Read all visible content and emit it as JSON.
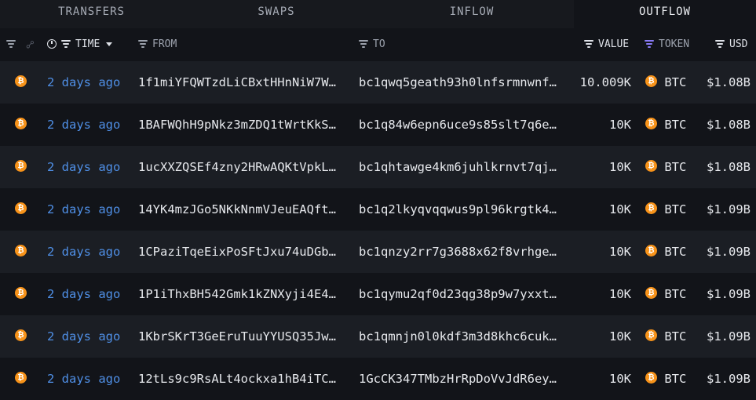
{
  "tabs": [
    {
      "label": "TRANSFERS",
      "active": false
    },
    {
      "label": "SWAPS",
      "active": false
    },
    {
      "label": "INFLOW",
      "active": false
    },
    {
      "label": "OUTFLOW",
      "active": true
    }
  ],
  "columns": {
    "time": "TIME",
    "from": "FROM",
    "to": "TO",
    "value": "VALUE",
    "token": "TOKEN",
    "usd": "USD"
  },
  "colors": {
    "background": "#121419",
    "row_alt": "#1b1e24",
    "time_link": "#4f8fe6",
    "btc_orange": "#f7931a",
    "token_filter_active": "#8b7cf6"
  },
  "icons": {
    "chain": "btc-icon",
    "token": "btc-icon",
    "filter": "filter-icon",
    "time": "clock-icon",
    "link": "link-icon",
    "sort": "caret-down-icon"
  },
  "rows": [
    {
      "time": "2 days ago",
      "from": "1f1miYFQWTzdLiCBxtHHnNiW7W…",
      "to": "bc1qwq5geath93h0lnfsrmnwnf…",
      "value": "10.009K",
      "token": "BTC",
      "usd": "$1.08B"
    },
    {
      "time": "2 days ago",
      "from": "1BAFWQhH9pNkz3mZDQ1tWrtKkS…",
      "to": "bc1q84w6epn6uce9s85slt7q6e…",
      "value": "10K",
      "token": "BTC",
      "usd": "$1.08B"
    },
    {
      "time": "2 days ago",
      "from": "1ucXXZQSEf4zny2HRwAQKtVpkL…",
      "to": "bc1qhtawge4km6juhlkrnvt7qj…",
      "value": "10K",
      "token": "BTC",
      "usd": "$1.08B"
    },
    {
      "time": "2 days ago",
      "from": "14YK4mzJGo5NKkNnmVJeuEAQft…",
      "to": "bc1q2lkyqvqqwus9pl96krgtk4…",
      "value": "10K",
      "token": "BTC",
      "usd": "$1.09B"
    },
    {
      "time": "2 days ago",
      "from": "1CPaziTqeEixPoSFtJxu74uDGb…",
      "to": "bc1qnzy2rr7g3688x62f8vrhge…",
      "value": "10K",
      "token": "BTC",
      "usd": "$1.09B"
    },
    {
      "time": "2 days ago",
      "from": "1P1iThxBH542Gmk1kZNXyji4E4…",
      "to": "bc1qymu2qf0d23qg38p9w7yxxt…",
      "value": "10K",
      "token": "BTC",
      "usd": "$1.09B"
    },
    {
      "time": "2 days ago",
      "from": "1KbrSKrT3GeEruTuuYYUSQ35Jw…",
      "to": "bc1qmnjn0l0kdf3m3d8khc6cuk…",
      "value": "10K",
      "token": "BTC",
      "usd": "$1.09B"
    },
    {
      "time": "2 days ago",
      "from": "12tLs9c9RsALt4ockxa1hB4iTC…",
      "to": "1GcCK347TMbzHrRpDoVvJdR6ey…",
      "value": "10K",
      "token": "BTC",
      "usd": "$1.09B"
    }
  ]
}
